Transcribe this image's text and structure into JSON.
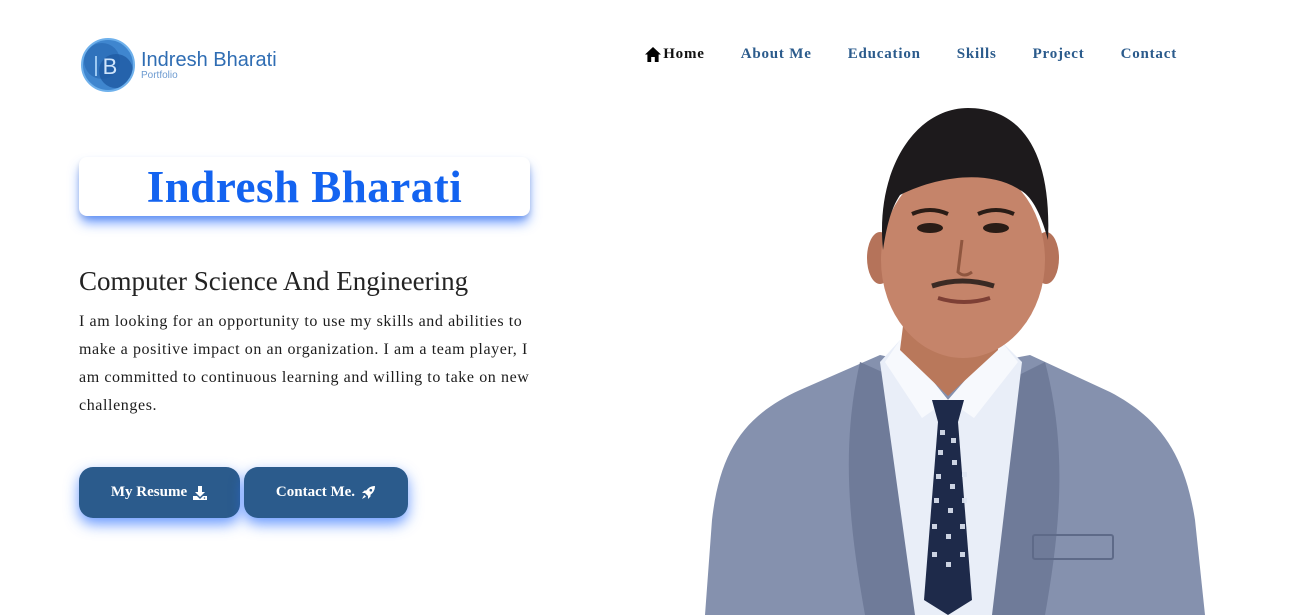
{
  "header": {
    "logo_letter": "B",
    "logo_name": "Indresh Bharati",
    "logo_sub": "Portfolio"
  },
  "nav": {
    "items": [
      {
        "label": "Home",
        "icon": "home-icon",
        "active": true
      },
      {
        "label": "About Me"
      },
      {
        "label": "Education"
      },
      {
        "label": "Skills"
      },
      {
        "label": "Project"
      },
      {
        "label": "Contact"
      }
    ]
  },
  "hero": {
    "name": "Indresh Bharati",
    "subtitle": "Computer Science And Engineering",
    "description": "I am looking for an opportunity to use my skills and abilities to make a positive impact on an organization. I am a team player, I am committed to continuous learning and willing to take on new challenges.",
    "buttons": {
      "resume_label": "My Resume",
      "resume_icon": "download-icon",
      "contact_label": "Contact Me.",
      "contact_icon": "rocket-icon"
    }
  },
  "colors": {
    "accent_blue": "#1363f0",
    "nav_blue": "#2b5b8c",
    "button_bg": "#2b5b8c",
    "glow": "#286eff"
  }
}
